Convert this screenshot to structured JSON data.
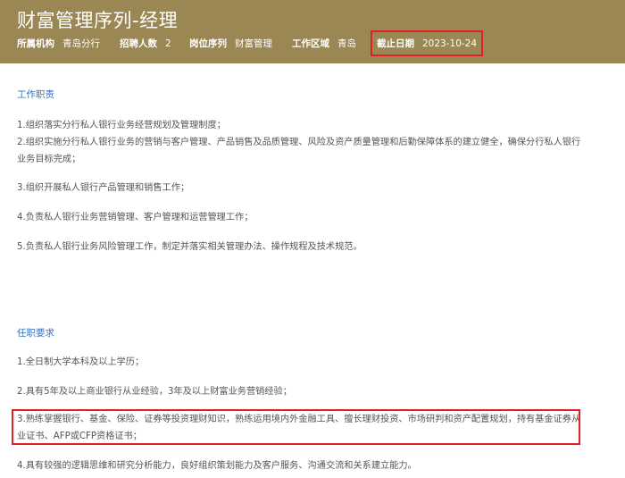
{
  "header": {
    "title": "财富管理序列-经理",
    "org_label": "所属机构",
    "org_value": "青岛分行",
    "count_label": "招聘人数",
    "count_value": "2",
    "seq_label": "岗位序列",
    "seq_value": "财富管理",
    "area_label": "工作区域",
    "area_value": "青岛",
    "deadline_label": "截止日期",
    "deadline_value": "2023-10-24"
  },
  "duties": {
    "title": "工作职责",
    "items": [
      "1.组织落实分行私人银行业务经营规划及管理制度；",
      "2.组织实施分行私人银行业务的营销与客户管理、产品销售及品质管理、风险及资产质量管理和后勤保障体系的建立健全，确保分行私人银行业务目标完成；",
      "3.组织开展私人银行产品管理和销售工作；",
      "4.负责私人银行业务营销管理、客户管理和运营管理工作；",
      "5.负责私人银行业务风险管理工作，制定并落实相关管理办法、操作规程及技术规范。"
    ]
  },
  "requirements": {
    "title": "任职要求",
    "items": [
      "1.全日制大学本科及以上学历；",
      "2.具有5年及以上商业银行从业经验，3年及以上财富业务营销经验；",
      "3.熟练掌握银行、基金、保险、证券等投资理财知识，熟练运用境内外金融工具、擅长理财投资、市场研判和资产配置规划，持有基金证券从业证书、AFP或CFP资格证书；",
      "4.具有较强的逻辑思维和研究分析能力，良好组织策划能力及客户服务、沟通交流和关系建立能力。"
    ]
  },
  "colors": {
    "header_bg": "#9b8753",
    "section_title": "#2a75c8",
    "highlight": "#e11f26"
  }
}
